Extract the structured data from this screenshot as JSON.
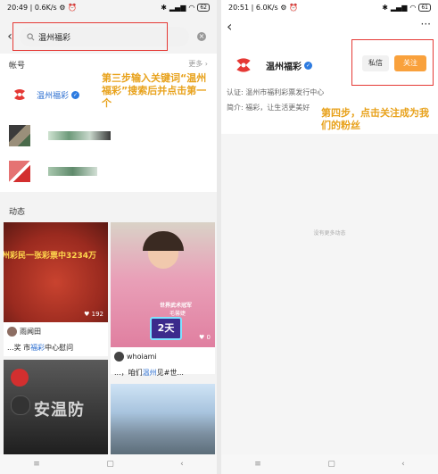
{
  "left": {
    "status": {
      "time": "20:49",
      "speed": "0.6K/s",
      "battery": "62"
    },
    "search": {
      "query": "温州福彩"
    },
    "accounts": {
      "heading": "帐号",
      "more": "更多",
      "first_name": "温州福彩"
    },
    "annotation": "第三步输入关键词“温州福彩”搜索后并点击第一个",
    "dynamics": {
      "heading": "动态",
      "cards": [
        {
          "overlay": "州彩民一张彩票中3234万",
          "likes": "192",
          "user": "雨闻田",
          "caption_pre": "...奖 市",
          "caption_hl": "福彩",
          "caption_post": "中心慰问"
        },
        {
          "big": "世界武术冠军",
          "sub": "毛馨婕",
          "days": "2天",
          "likes": "0",
          "user": "whoiami",
          "caption_pre": "...，咱们",
          "caption_hl": "温州",
          "caption_post": "见#世..."
        },
        {
          "overlay": "安温防"
        },
        {}
      ]
    }
  },
  "right": {
    "status": {
      "time": "20:51",
      "speed": "6.0K/s",
      "battery": "61"
    },
    "profile": {
      "name": "温州福彩",
      "certification": "认证: 温州市福利彩票发行中心",
      "bio": "简介: 福彩，让生活更美好",
      "message_button": "私信",
      "follow_button": "关注"
    },
    "annotation": "第四步，点击关注成为我们的粉丝",
    "empty": "没有更多动态"
  },
  "colors": {
    "accent": "#e53935",
    "follow": "#f9a13c",
    "annotation": "#e8a21c",
    "verified": "#2d7be0"
  }
}
